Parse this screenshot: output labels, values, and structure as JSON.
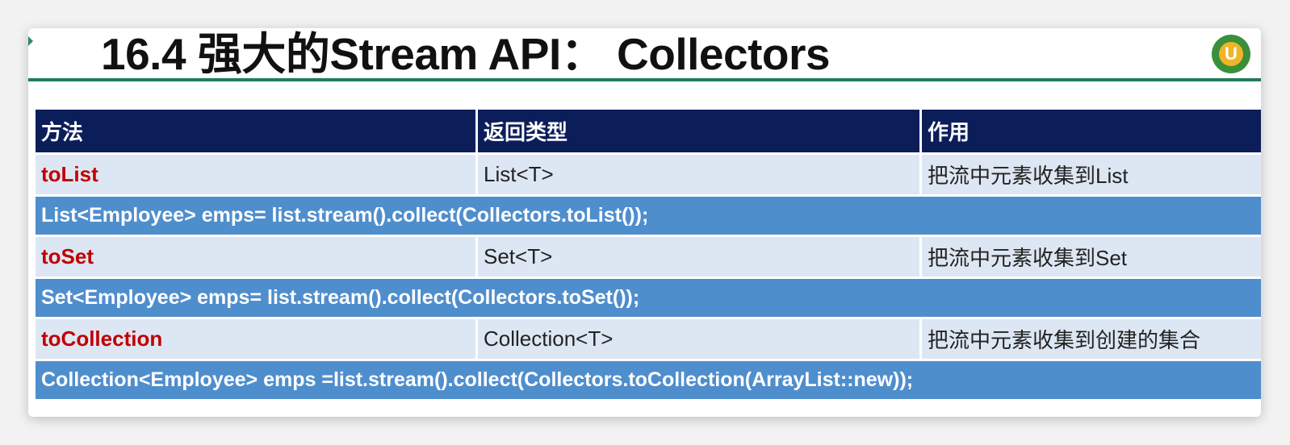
{
  "slide": {
    "title": "16.4 强大的Stream API： Collectors",
    "logo_glyph": "U",
    "colors": {
      "title_rule": "#237a5e",
      "header_bg": "#0c1e5a",
      "method_row_bg": "#dde7f3",
      "example_row_bg": "#4f8ecd",
      "method_name": "#c00000"
    }
  },
  "table": {
    "headers": [
      "方法",
      "返回类型",
      "作用"
    ],
    "rows": [
      {
        "method": "toList",
        "return_type": "List<T>",
        "purpose": "把流中元素收集到List",
        "example": "List<Employee> emps= list.stream().collect(Collectors.toList());"
      },
      {
        "method": "toSet",
        "return_type": "Set<T>",
        "purpose": "把流中元素收集到Set",
        "example": "Set<Employee> emps= list.stream().collect(Collectors.toSet());"
      },
      {
        "method": "toCollection",
        "return_type": "Collection<T>",
        "purpose": "把流中元素收集到创建的集合",
        "example": "Collection<Employee> emps =list.stream().collect(Collectors.toCollection(ArrayList::new));"
      }
    ]
  }
}
